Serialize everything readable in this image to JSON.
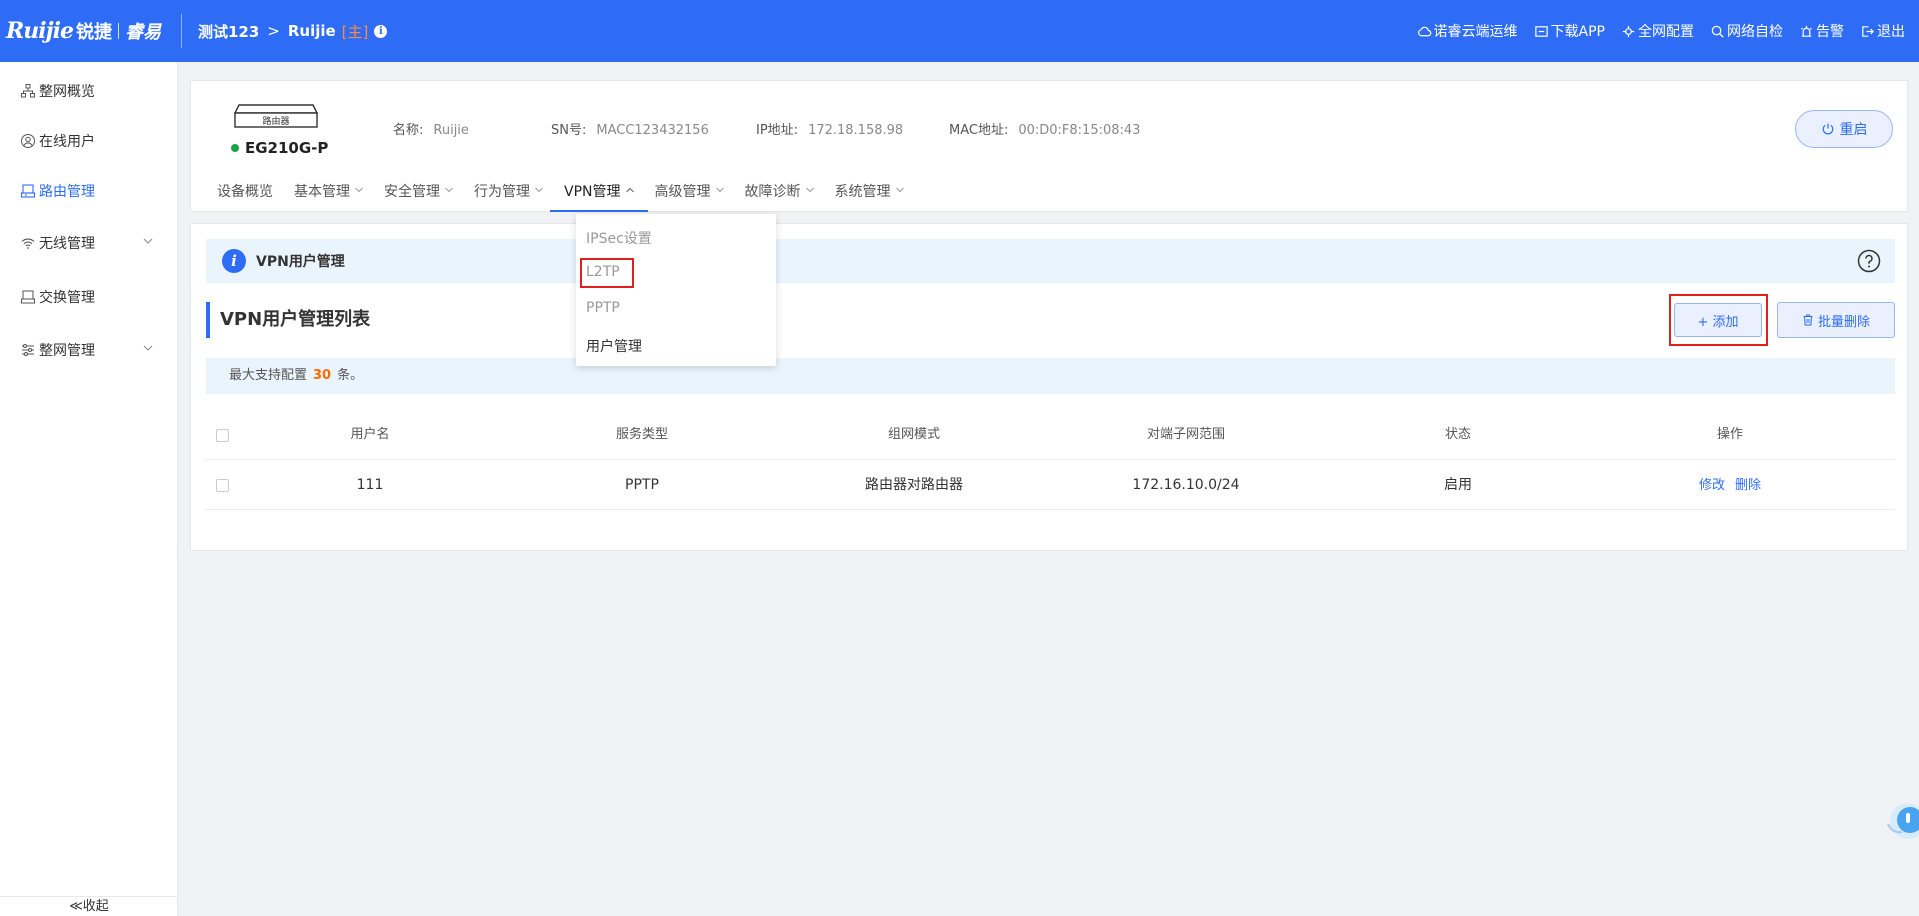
{
  "brand": {
    "logo_main": "Ruijie",
    "logo_cn": "锐捷",
    "logo_sub": "睿易"
  },
  "breadcrumb": {
    "project": "测试123",
    "device": "Ruijie",
    "tag": "[主]"
  },
  "top_actions": [
    {
      "label": "诺睿云端运维",
      "icon": "cloud-icon"
    },
    {
      "label": "下载APP",
      "icon": "download-icon"
    },
    {
      "label": "全网配置",
      "icon": "network-config-icon"
    },
    {
      "label": "网络自检",
      "icon": "inspect-icon"
    },
    {
      "label": "告警",
      "icon": "alarm-icon"
    },
    {
      "label": "退出",
      "icon": "logout-icon"
    }
  ],
  "sidebar": {
    "items": [
      {
        "label": "整网概览",
        "icon": "topology-icon"
      },
      {
        "label": "在线用户",
        "icon": "user-icon"
      },
      {
        "label": "路由管理",
        "icon": "router-icon",
        "active": true
      },
      {
        "label": "无线管理",
        "icon": "wifi-icon",
        "expandable": true
      },
      {
        "label": "交换管理",
        "icon": "switch-icon"
      },
      {
        "label": "整网管理",
        "icon": "settings-sliders-icon",
        "expandable": true
      }
    ],
    "collapse_label": "≪收起"
  },
  "device": {
    "image_label": "路由器",
    "model": "EG210G-P",
    "status_color": "#1aa34a",
    "name_label": "名称:",
    "name_value": "Ruijie",
    "sn_label": "SN号:",
    "sn_value": "MACC123432156",
    "ip_label": "IP地址:",
    "ip_value": "172.18.158.98",
    "mac_label": "MAC地址:",
    "mac_value": "00:D0:F8:15:08:43",
    "restart_label": "重启"
  },
  "device_tabs": [
    {
      "label": "设备概览",
      "has_arrow": false
    },
    {
      "label": "基本管理",
      "has_arrow": true
    },
    {
      "label": "安全管理",
      "has_arrow": true
    },
    {
      "label": "行为管理",
      "has_arrow": true
    },
    {
      "label": "VPN管理",
      "has_arrow": true,
      "active": true
    },
    {
      "label": "高级管理",
      "has_arrow": true
    },
    {
      "label": "故障诊断",
      "has_arrow": true
    },
    {
      "label": "系统管理",
      "has_arrow": true
    }
  ],
  "vpn_dropdown": {
    "items": [
      "IPSec设置",
      "L2TP",
      "PPTP",
      "用户管理"
    ]
  },
  "page": {
    "info_title": "VPN用户管理",
    "section_title": "VPN用户管理列表",
    "add_label": "+ 添加",
    "batch_delete_label": "批量删除",
    "note_prefix": "最大支持配置",
    "note_count": "30",
    "note_suffix": "条。"
  },
  "table": {
    "headers": [
      "用户名",
      "服务类型",
      "组网模式",
      "对端子网范围",
      "状态",
      "操作"
    ],
    "rows": [
      {
        "username": "111",
        "service": "PPTP",
        "mode": "路由器对路由器",
        "subnet": "172.16.10.0/24",
        "status": "启用",
        "edit": "修改",
        "delete": "删除"
      }
    ]
  },
  "colors": {
    "primary": "#2e6cf6",
    "highlight": "#e02020",
    "accent_number": "#ff6a00"
  }
}
